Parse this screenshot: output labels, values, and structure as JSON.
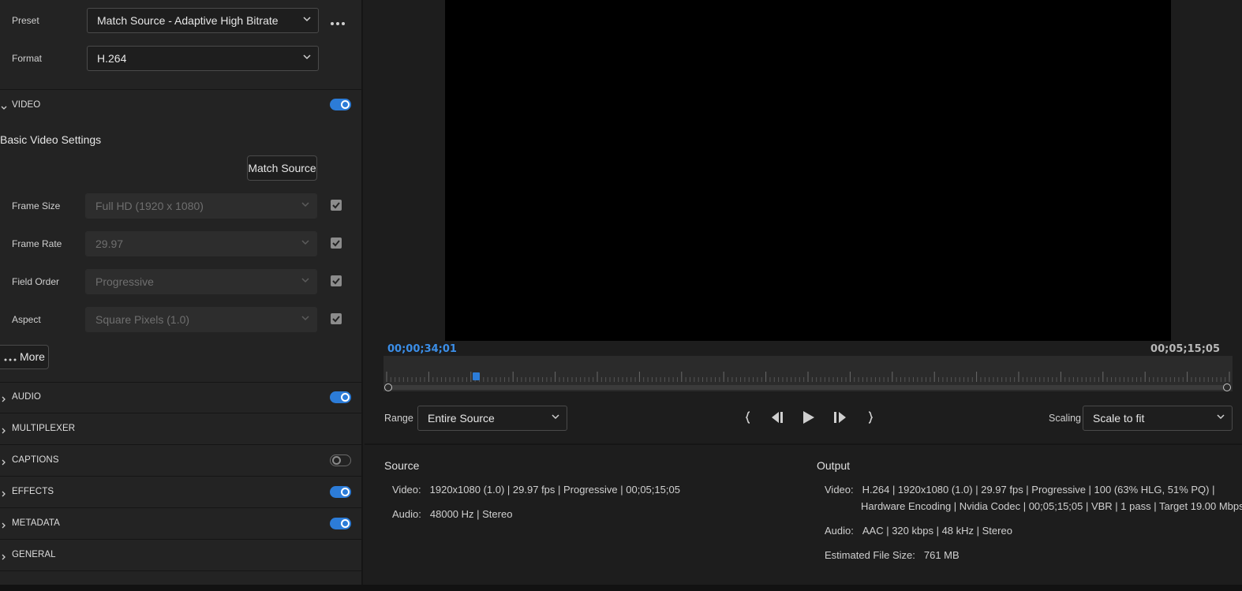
{
  "preset": {
    "label": "Preset",
    "value": "Match Source - Adaptive High Bitrate",
    "more_icon": "ellipsis-icon"
  },
  "format": {
    "label": "Format",
    "value": "H.264"
  },
  "video_section": {
    "label": "VIDEO",
    "enabled": true
  },
  "basic_video": {
    "heading": "Basic Video Settings",
    "match_source_label": "Match Source",
    "rows": [
      {
        "label": "Frame Size",
        "value": "Full HD (1920 x 1080)",
        "checked": true
      },
      {
        "label": "Frame Rate",
        "value": "29.97",
        "checked": true
      },
      {
        "label": "Field Order",
        "value": "Progressive",
        "checked": true
      },
      {
        "label": "Aspect",
        "value": "Square Pixels (1.0)",
        "checked": true
      }
    ],
    "more_label": "More"
  },
  "sections": [
    {
      "label": "AUDIO",
      "toggle": "on"
    },
    {
      "label": "MULTIPLEXER",
      "toggle": "none"
    },
    {
      "label": "CAPTIONS",
      "toggle": "off"
    },
    {
      "label": "EFFECTS",
      "toggle": "on"
    },
    {
      "label": "METADATA",
      "toggle": "on"
    },
    {
      "label": "GENERAL",
      "toggle": "none"
    }
  ],
  "timeline": {
    "current_tc": "00;00;34;01",
    "end_tc": "00;05;15;05",
    "playhead_position": 0.105
  },
  "controls": {
    "range_label": "Range",
    "range_value": "Entire Source",
    "scaling_label": "Scaling",
    "scaling_value": "Scale to fit",
    "icons": [
      "set-in-point-icon",
      "step-back-icon",
      "play-icon",
      "step-forward-icon",
      "set-out-point-icon"
    ]
  },
  "source": {
    "title": "Source",
    "video_key": "Video:",
    "video_value": "1920x1080 (1.0)  |  29.97 fps  |  Progressive  |  00;05;15;05",
    "audio_key": "Audio:",
    "audio_value": "48000 Hz  |  Stereo"
  },
  "output": {
    "title": "Output",
    "video_key": "Video:",
    "video_value_1": "H.264  |  1920x1080 (1.0)  |  29.97 fps  |  Progressive  |  100 (63% HLG, 51% PQ)  |",
    "video_value_2": "Hardware Encoding  |  Nvidia Codec  |  00;05;15;05   |  VBR  |  1 pass  |  Target 19.00 Mbps",
    "audio_key": "Audio:",
    "audio_value": "AAC  |  320 kbps  |  48 kHz  |  Stereo",
    "size_key": "Estimated File Size:",
    "size_value": "761 MB"
  },
  "colors": {
    "accent": "#2c7cd8",
    "background": "#1d1d1d",
    "panel": "#232323"
  }
}
